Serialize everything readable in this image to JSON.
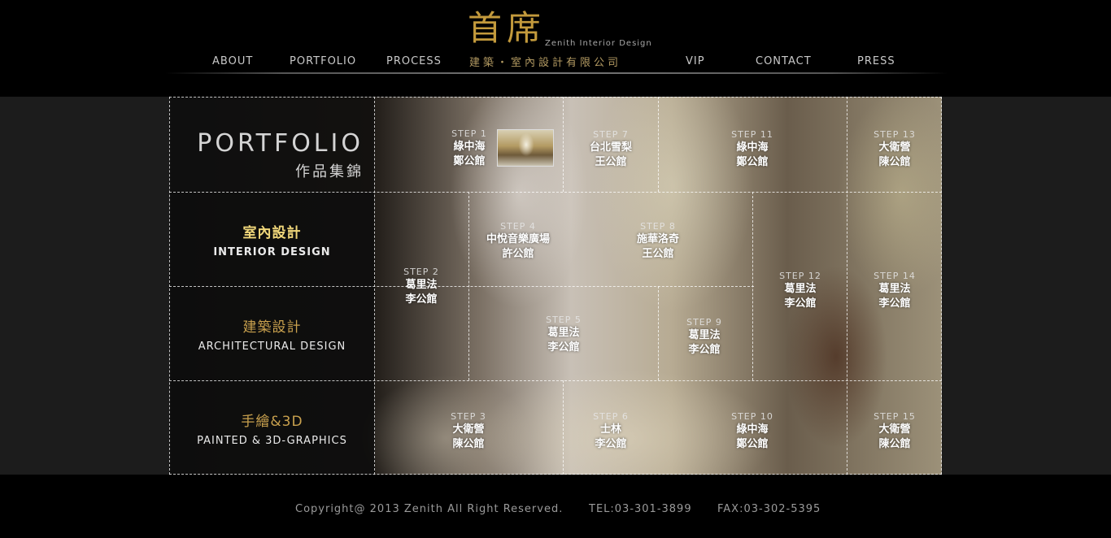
{
  "nav": {
    "about": "ABOUT",
    "portfolio": "PORTFOLIO",
    "process": "PROCESS",
    "vip": "VIP",
    "contact": "CONTACT",
    "press": "PRESS"
  },
  "logo": {
    "name_cn": "首席",
    "name_en": "Zenith Interior Design",
    "company": "建築・室內設計有限公司"
  },
  "sidebar": {
    "title": "PORTFOLIO",
    "title_cn": "作品集錦",
    "categories": [
      {
        "cn": "室內設計",
        "en": "INTERIOR DESIGN",
        "active": true
      },
      {
        "cn": "建築設計",
        "en": "ARCHITECTURAL DESIGN",
        "active": false
      },
      {
        "cn": "手繪&3D",
        "en": "PAINTED & 3D-GRAPHICS",
        "active": false
      }
    ]
  },
  "steps": [
    {
      "num": "STEP 1",
      "line1": "綠中海",
      "line2": "鄭公館"
    },
    {
      "num": "STEP 2",
      "line1": "葛里法",
      "line2": "李公館"
    },
    {
      "num": "STEP 3",
      "line1": "大衛營",
      "line2": "陳公館"
    },
    {
      "num": "STEP 4",
      "line1": "中悅音樂廣場",
      "line2": "許公館"
    },
    {
      "num": "STEP 5",
      "line1": "葛里法",
      "line2": "李公館"
    },
    {
      "num": "STEP 6",
      "line1": "士林",
      "line2": "李公館"
    },
    {
      "num": "STEP 7",
      "line1": "台北雪梨",
      "line2": "王公館"
    },
    {
      "num": "STEP 8",
      "line1": "施華洛奇",
      "line2": "王公館"
    },
    {
      "num": "STEP 9",
      "line1": "葛里法",
      "line2": "李公館"
    },
    {
      "num": "STEP 10",
      "line1": "綠中海",
      "line2": "鄭公館"
    },
    {
      "num": "STEP 11",
      "line1": "綠中海",
      "line2": "鄭公館"
    },
    {
      "num": "STEP 12",
      "line1": "葛里法",
      "line2": "李公館"
    },
    {
      "num": "STEP 13",
      "line1": "大衛營",
      "line2": "陳公館"
    },
    {
      "num": "STEP 14",
      "line1": "葛里法",
      "line2": "李公館"
    },
    {
      "num": "STEP 15",
      "line1": "大衛營",
      "line2": "陳公館"
    }
  ],
  "footer": {
    "copyright": "Copyright@ 2013 Zenith All Right Reserved.",
    "tel": "TEL:03-301-3899",
    "fax": "FAX:03-302-5395"
  },
  "colors": {
    "gold": "#c39a3c",
    "active_gold": "#f0d77a",
    "background": "#000000"
  }
}
